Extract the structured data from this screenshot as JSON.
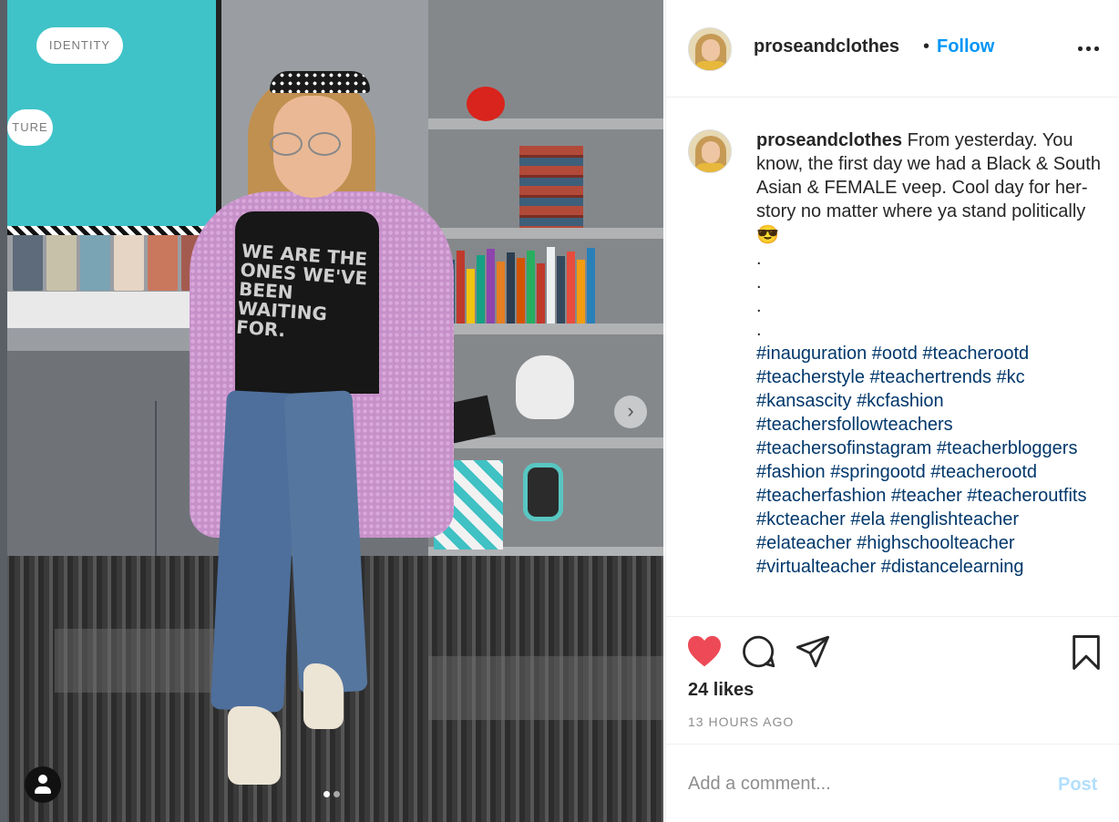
{
  "post": {
    "username": "proseandclothes",
    "header_separator": "•",
    "follow_label": "Follow",
    "more_icon": "more-options-icon",
    "photo": {
      "shirt_text": "WE ARE THE ONES WE'VE BEEN WAITING FOR.",
      "carousel_total": 2,
      "carousel_index": 1,
      "next_icon": "chevron-right-icon",
      "tag_icon": "user-tag-icon"
    },
    "caption": {
      "username": "proseandclothes",
      "text": "From yesterday. You know, the first day we had a Black & South Asian & FEMALE veep. Cool day for her-story no matter where ya stand politically 😎",
      "dots": [
        ".",
        ".",
        ".",
        "."
      ],
      "hashtags": [
        "#inauguration",
        "#ootd",
        "#teacherootd",
        "#teacherstyle",
        "#teachertrends",
        "#kc",
        "#kansascity",
        "#kcfashion",
        "#teachersfollowteachers",
        "#teachersofinstagram",
        "#teacherbloggers",
        "#fashion",
        "#springootd",
        "#teacherootd",
        "#teacherfashion",
        "#teacher",
        "#teacheroutfits",
        "#kcteacher",
        "#ela",
        "#englishteacher",
        "#elateacher",
        "#highschoolteacher",
        "#virtualteacher",
        "#distancelearning"
      ]
    },
    "actions": {
      "like_icon": "heart-filled-icon",
      "comment_icon": "comment-icon",
      "share_icon": "paper-plane-icon",
      "save_icon": "bookmark-icon",
      "like_color": "#ed4956"
    },
    "likes_text": "24 likes",
    "timestamp": "13 HOURS AGO",
    "comment_box": {
      "placeholder": "Add a comment...",
      "value": "",
      "post_label": "Post"
    }
  },
  "colors": {
    "link_blue": "#0095f6",
    "hashtag": "#00376b",
    "muted": "#8e8e8e",
    "post_disabled": "#b2dffc"
  }
}
